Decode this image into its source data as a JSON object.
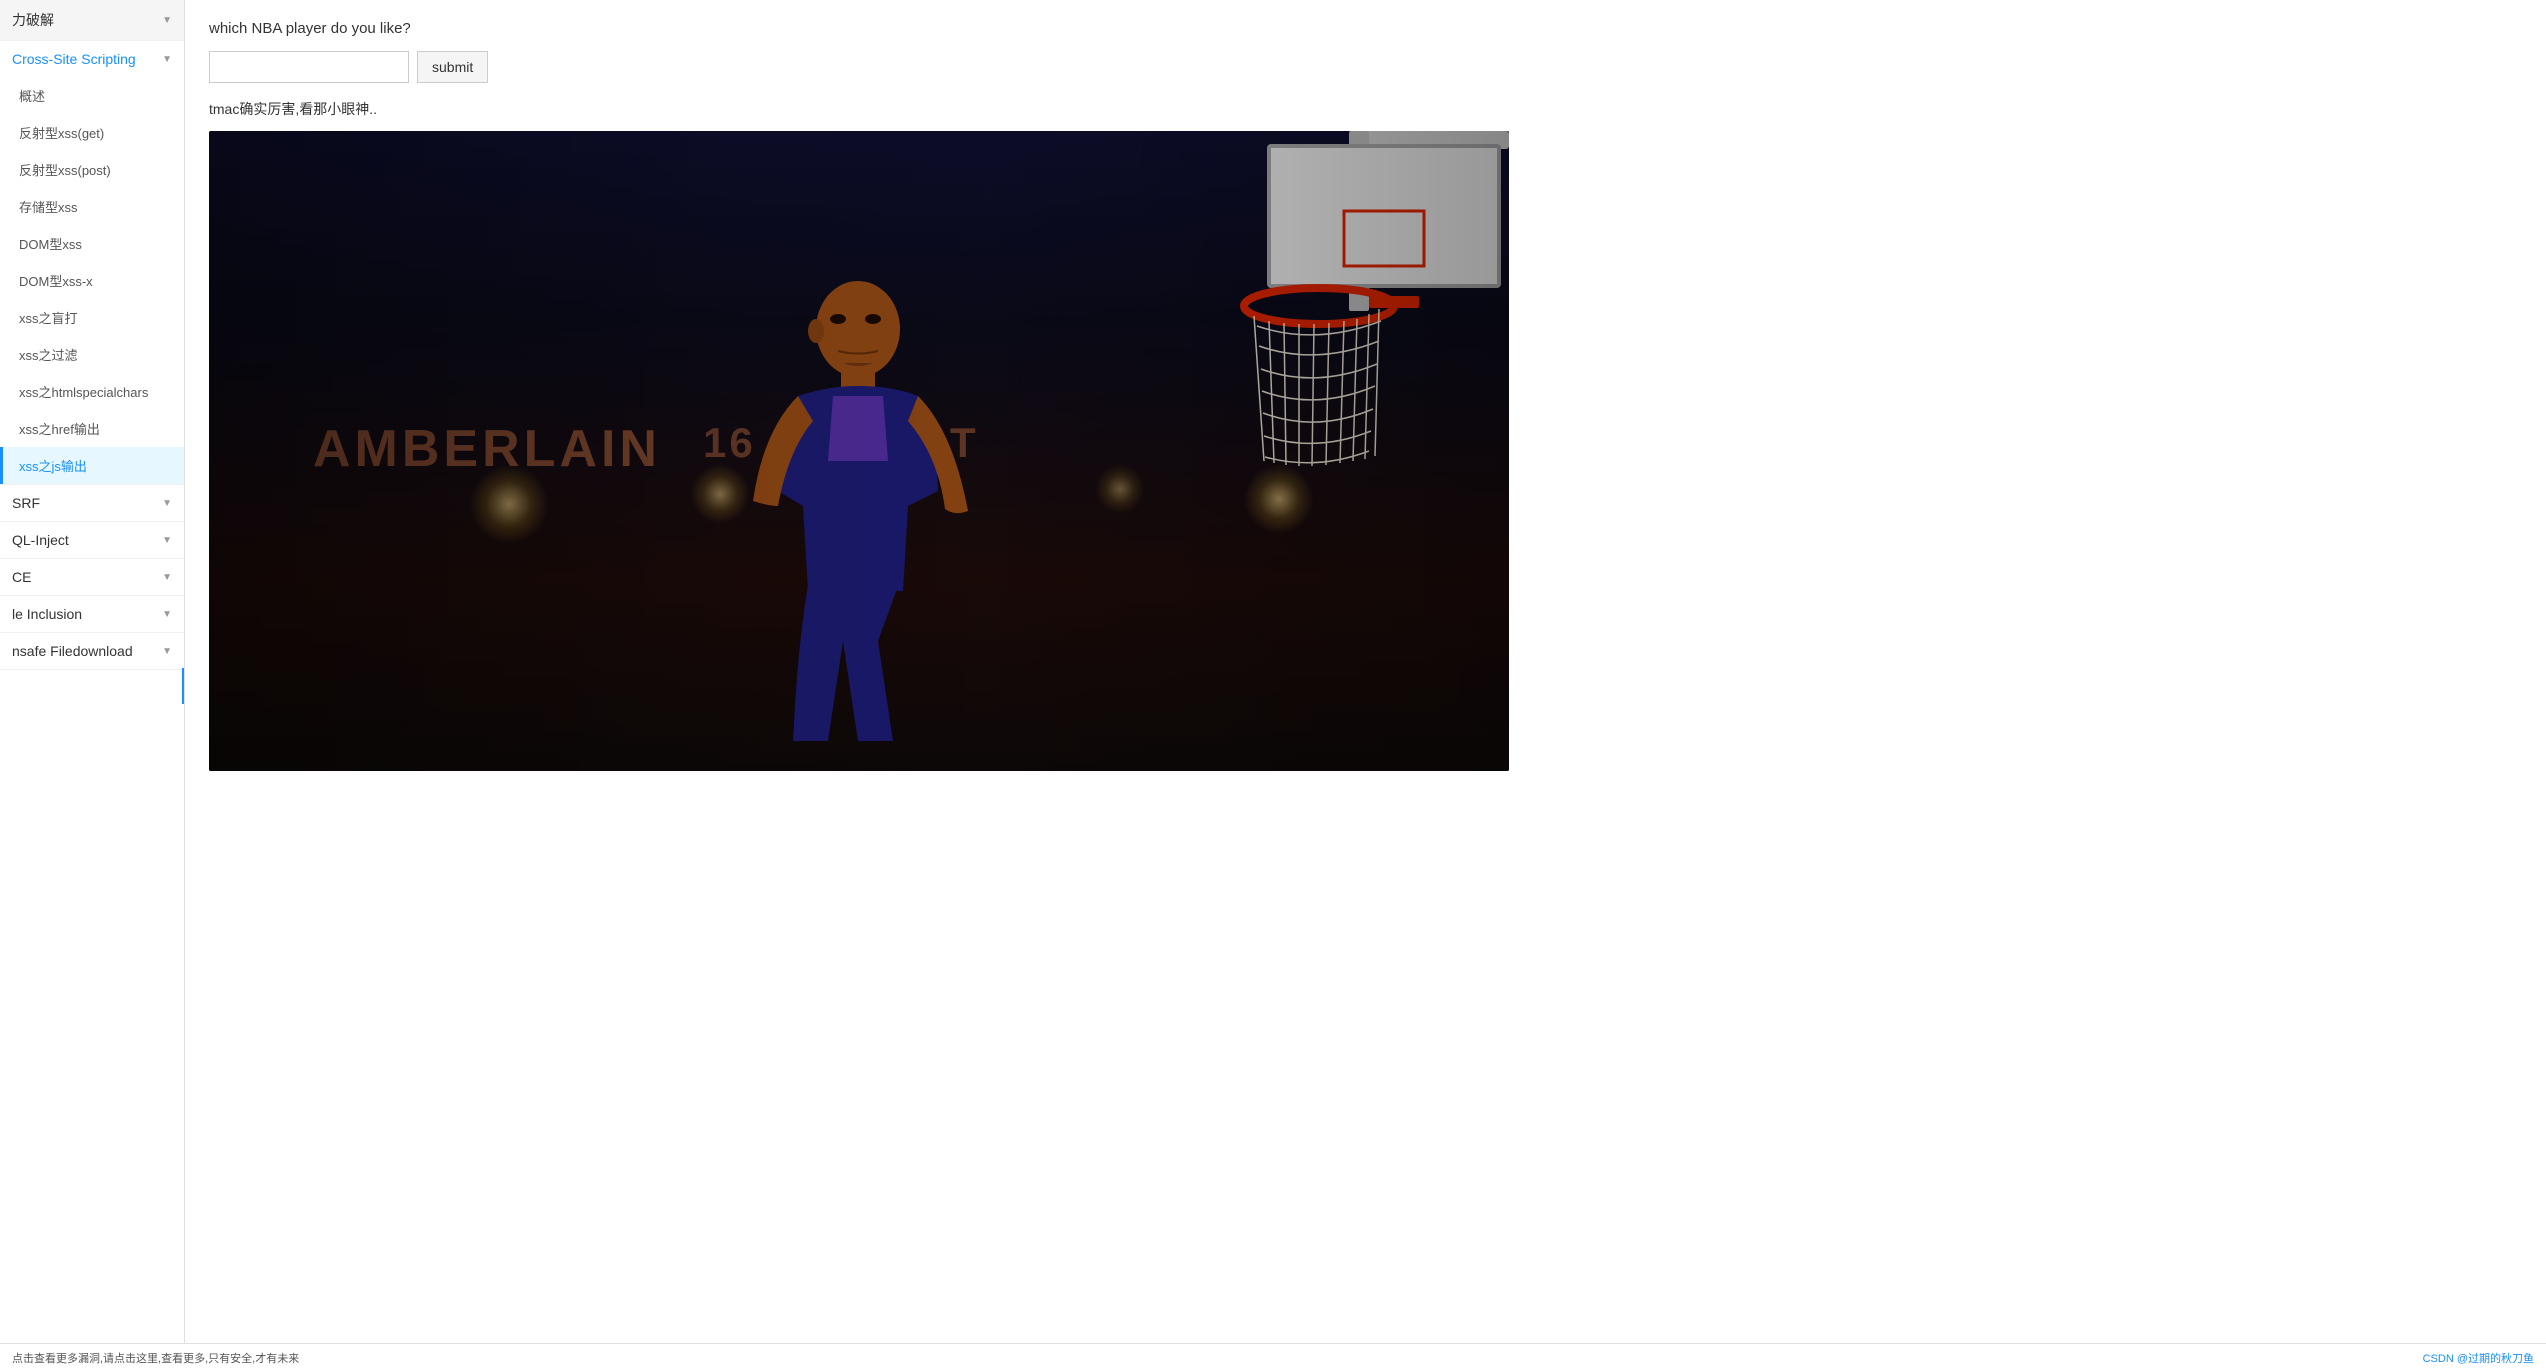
{
  "sidebar": {
    "sections": [
      {
        "id": "brute-force",
        "label": "力破解",
        "expanded": false,
        "chevron": "▼"
      },
      {
        "id": "xss",
        "label": "Cross-Site Scripting",
        "expanded": true,
        "chevron": "▼",
        "items": [
          {
            "id": "overview",
            "label": "概述",
            "active": false
          },
          {
            "id": "reflected-get",
            "label": "反射型xss(get)",
            "active": false
          },
          {
            "id": "reflected-post",
            "label": "反射型xss(post)",
            "active": false
          },
          {
            "id": "stored",
            "label": "存储型xss",
            "active": false
          },
          {
            "id": "dom",
            "label": "DOM型xss",
            "active": false
          },
          {
            "id": "dom-x",
            "label": "DOM型xss-x",
            "active": false
          },
          {
            "id": "blind",
            "label": "xss之盲打",
            "active": false
          },
          {
            "id": "filter",
            "label": "xss之过滤",
            "active": false
          },
          {
            "id": "htmlspecialchars",
            "label": "xss之htmlspecialchars",
            "active": false
          },
          {
            "id": "href",
            "label": "xss之href输出",
            "active": false
          },
          {
            "id": "js-output",
            "label": "xss之js输出",
            "active": true
          }
        ]
      },
      {
        "id": "csrf",
        "label": "SRF",
        "expanded": false,
        "chevron": "▼"
      },
      {
        "id": "sql-inject",
        "label": "QL-Inject",
        "expanded": false,
        "chevron": "▼"
      },
      {
        "id": "rce",
        "label": "CE",
        "expanded": false,
        "chevron": "▼"
      },
      {
        "id": "file-inclusion",
        "label": "le Inclusion",
        "expanded": false,
        "chevron": "▼"
      },
      {
        "id": "file-download",
        "label": "nsafe Filedownload",
        "expanded": false,
        "chevron": "▼"
      }
    ]
  },
  "main": {
    "question": "which NBA player do you like?",
    "input_placeholder": "",
    "submit_label": "submit",
    "result_text": "tmac确实厉害,看那小眼神..",
    "image_alt": "Basketball player looking up at rim"
  },
  "footer": {
    "left_text": "点击查看更多漏洞,请点击这里,查看更多,只有安全,才有未来",
    "right_text": "CSDN @过期的秋刀鱼"
  },
  "icons": {
    "chevron_down": "▼",
    "chevron_left": "◀"
  }
}
